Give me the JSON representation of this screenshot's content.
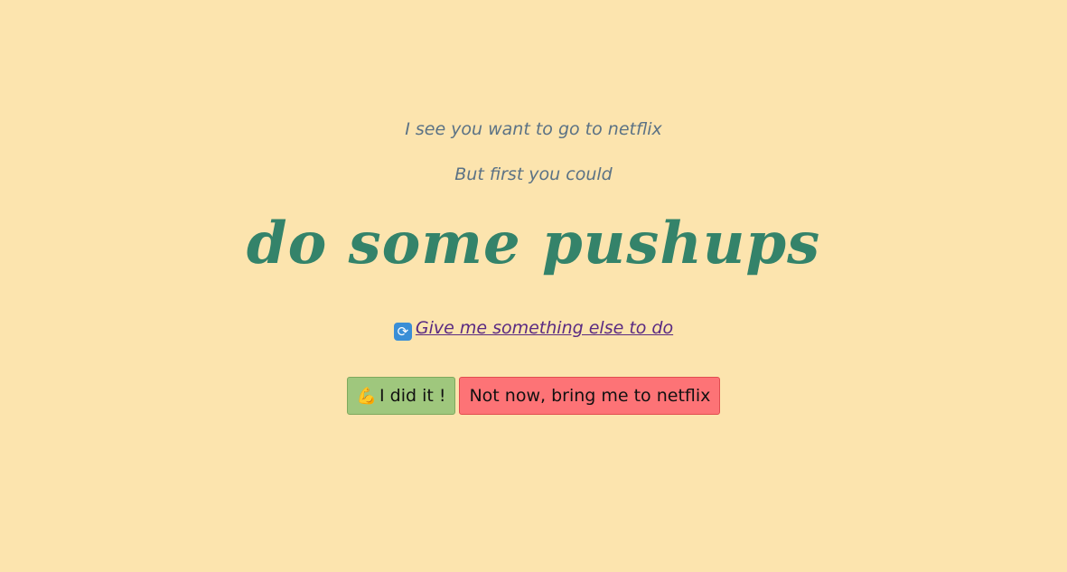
{
  "intro": {
    "line1": "I see you want to go to netflix",
    "line2": "But first you could"
  },
  "activity": "do some pushups",
  "other_link": {
    "icon": "refresh-icon",
    "icon_glyph": "⟳",
    "label": "Give me something else to do"
  },
  "buttons": {
    "done": {
      "icon": "flexed-biceps-icon",
      "icon_glyph": "💪",
      "label": "I did it !"
    },
    "skip": {
      "label": "Not now, bring me to netflix"
    }
  },
  "colors": {
    "background": "#fce4ae",
    "activity_text": "#34836a",
    "intro_text": "#5b7285",
    "link": "#5a2a82",
    "done_button": "#9fc77d",
    "skip_button": "#fd7376"
  }
}
